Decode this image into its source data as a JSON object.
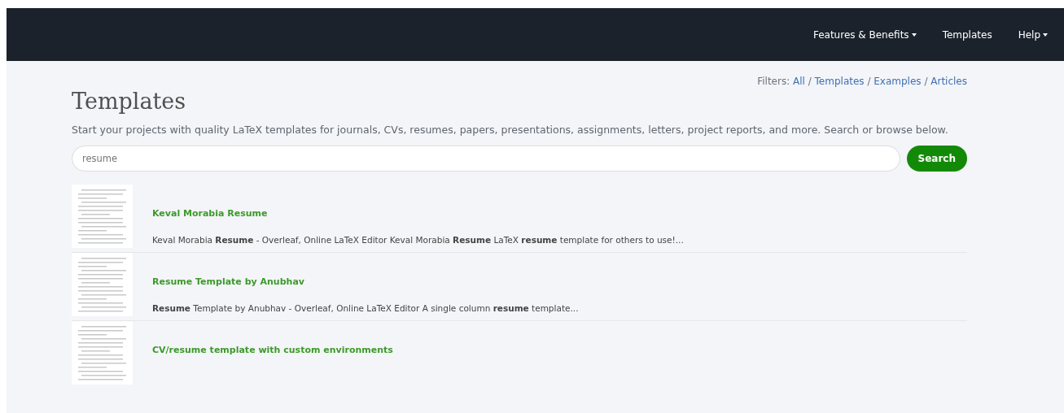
{
  "navbar": {
    "items": [
      {
        "label": "Features & Benefits",
        "dropdown": true
      },
      {
        "label": "Templates",
        "dropdown": false
      },
      {
        "label": "Help",
        "dropdown": true
      }
    ]
  },
  "filters": {
    "label": "Filters:",
    "links": [
      "All",
      "Templates",
      "Examples",
      "Articles"
    ],
    "separator": "/"
  },
  "heading": "Templates",
  "intro": "Start your projects with quality LaTeX templates for journals, CVs, resumes, papers, presentations, assignments, letters, project reports, and more. Search or browse below.",
  "search": {
    "value": "resume",
    "button": "Search"
  },
  "results": [
    {
      "title": "Keval Morabia Resume",
      "snippet": "Keval Morabia **Resume** - Overleaf, Online LaTeX Editor Keval Morabia **Resume** LaTeX **resume** template for others to use!..."
    },
    {
      "title": "Resume Template by Anubhav",
      "snippet": "**Resume** Template by Anubhav - Overleaf, Online LaTeX Editor A single column **resume** template..."
    },
    {
      "title": "CV/resume template with custom environments"
    }
  ]
}
